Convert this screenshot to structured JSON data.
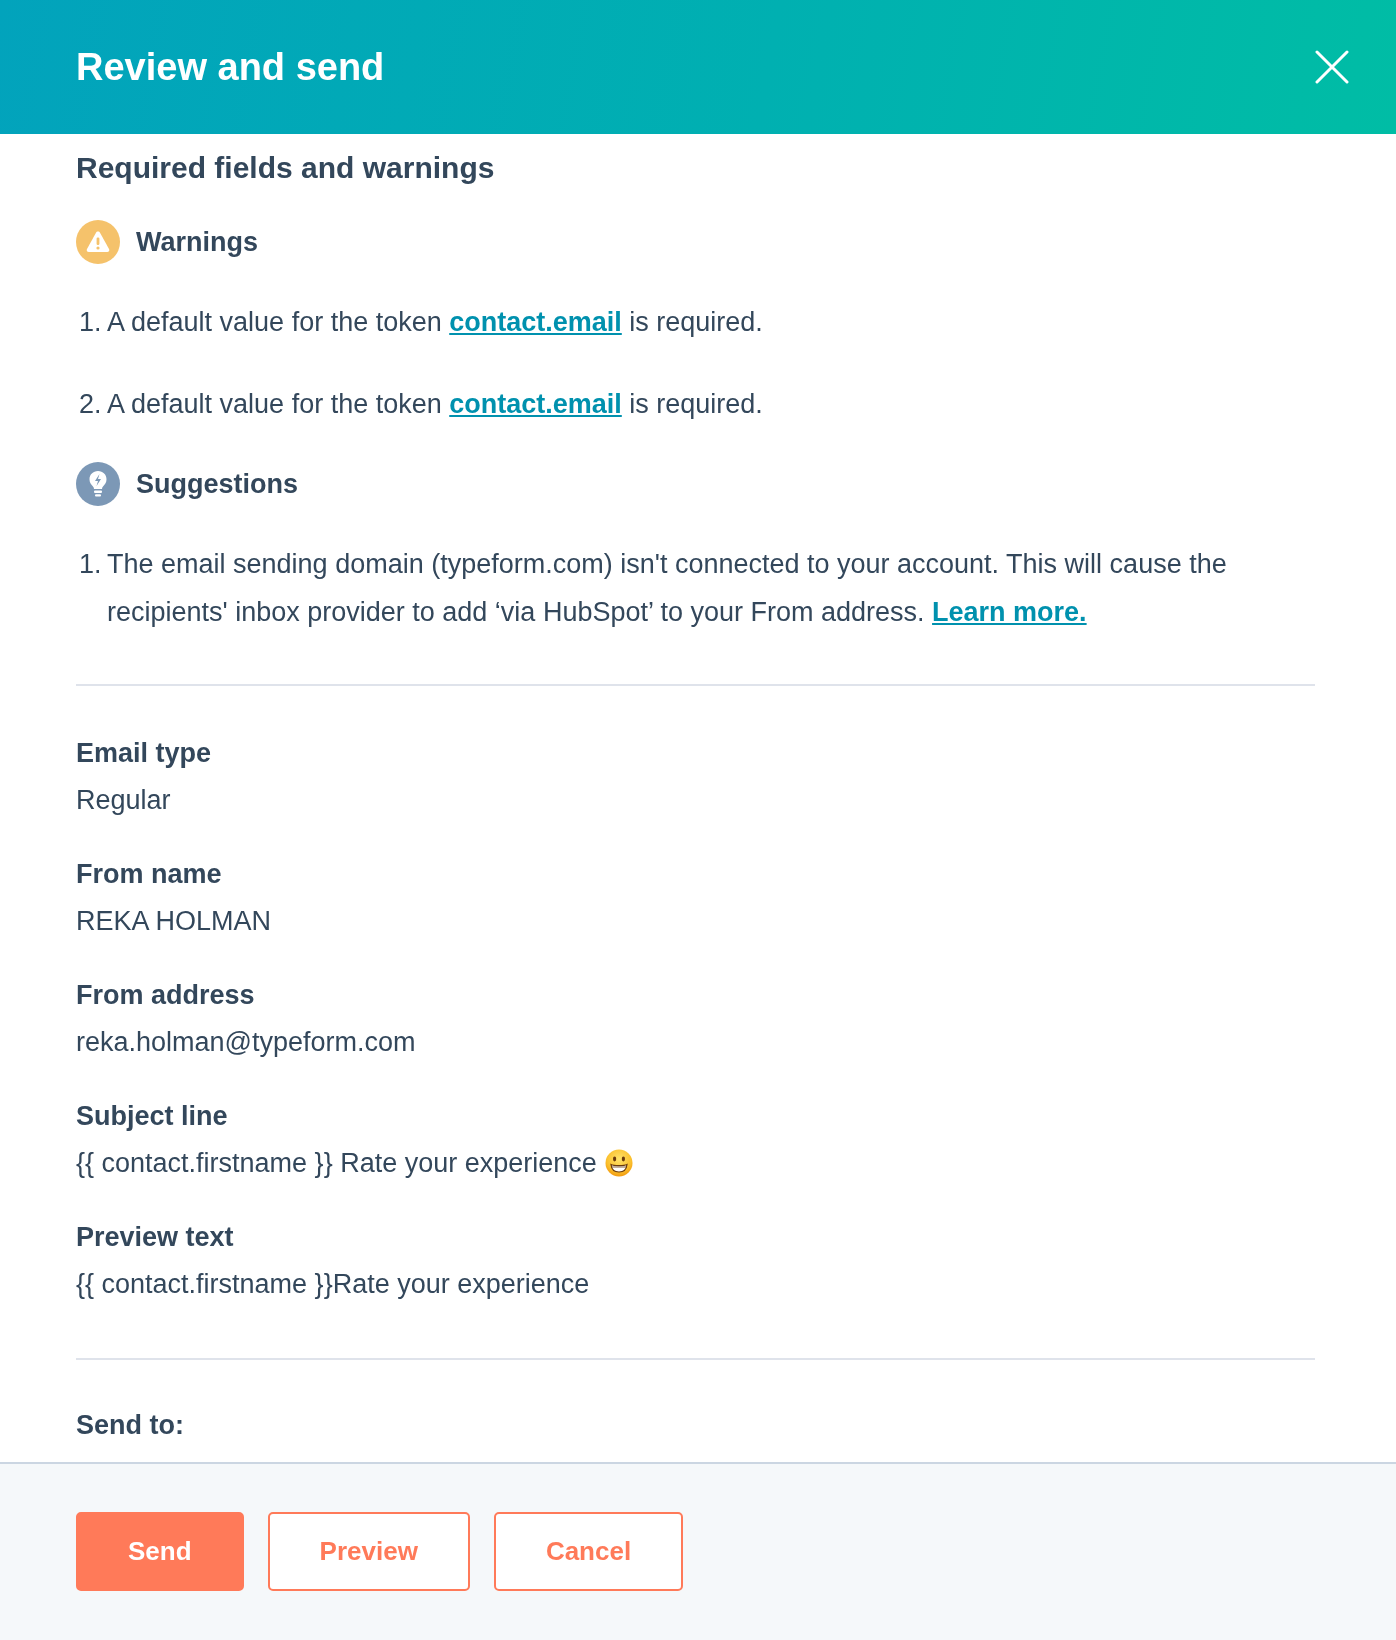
{
  "dialog": {
    "title": "Review and send"
  },
  "checks": {
    "heading": "Required fields and warnings",
    "groups": [
      {
        "kind": "warning",
        "title": "Warnings",
        "items": [
          {
            "number": "1.",
            "text": "A default value for the token ",
            "link": "contact.email",
            "after": " is required."
          },
          {
            "number": "2.",
            "text": "A default value for the token ",
            "link": "contact.email",
            "after": " is required."
          }
        ]
      },
      {
        "kind": "suggestion",
        "title": "Suggestions",
        "items": [
          {
            "number": "1.",
            "text": "The email sending domain (typeform.com) isn't connected to your account. This will cause the recipients' inbox provider to add ‘via HubSpot’ to your From address. ",
            "link": "Learn more."
          }
        ]
      }
    ]
  },
  "details": [
    {
      "label": "Email type",
      "value": "Regular",
      "emoji": false
    },
    {
      "label": "From name",
      "value": "REKA HOLMAN",
      "emoji": false
    },
    {
      "label": "From address",
      "value": "reka.holman@typeform.com",
      "emoji": false
    },
    {
      "label": "Subject line",
      "value": "{{ contact.firstname }} Rate your experience",
      "emoji": true
    },
    {
      "label": "Preview text",
      "value": "{{ contact.firstname }}Rate your experience",
      "emoji": false
    }
  ],
  "send_to": {
    "label": "Send to:"
  },
  "buttons": [
    {
      "label": "Send",
      "kind": "primary"
    },
    {
      "label": "Preview",
      "kind": "secondary"
    },
    {
      "label": "Cancel",
      "kind": "secondary"
    }
  ]
}
